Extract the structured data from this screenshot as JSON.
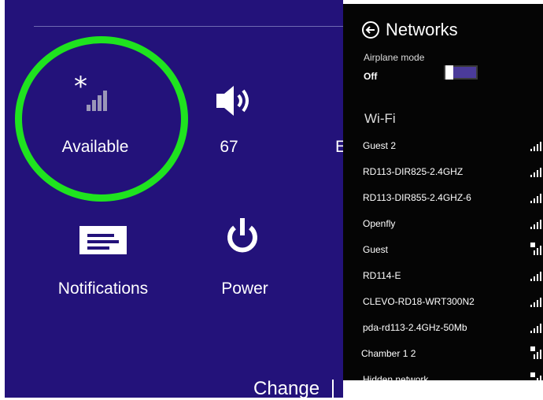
{
  "settings": {
    "tiles": {
      "network": {
        "label": "Available",
        "icon": "wifi-star-icon"
      },
      "volume": {
        "label": "67",
        "icon": "speaker-icon"
      },
      "clipped": {
        "label": "E"
      },
      "notifications": {
        "label": "Notifications",
        "icon": "notifications-icon"
      },
      "power": {
        "label": "Power",
        "icon": "power-icon"
      }
    },
    "change_link": "Change",
    "highlight_color": "#1fe31f",
    "background_color": "#23127a"
  },
  "networks": {
    "title": "Networks",
    "back_icon": "back-arrow-icon",
    "airplane_mode": {
      "label": "Airplane mode",
      "value": "Off"
    },
    "wifi_heading": "Wi-Fi",
    "items": [
      {
        "name": "Guest 2",
        "secured": false
      },
      {
        "name": "RD113-DIR825-2.4GHZ",
        "secured": false
      },
      {
        "name": "RD113-DIR855-2.4GHZ-6",
        "secured": false
      },
      {
        "name": "Openfly",
        "secured": false
      },
      {
        "name": "Guest",
        "secured": true
      },
      {
        "name": "RD114-E",
        "secured": false
      },
      {
        "name": "CLEVO-RD18-WRT300N2",
        "secured": false
      },
      {
        "name": "pda-rd113-2.4GHz-50Mb",
        "secured": false
      },
      {
        "name": "Chamber 1 2",
        "secured": true
      },
      {
        "name": "Hidden network",
        "secured": true
      }
    ]
  }
}
